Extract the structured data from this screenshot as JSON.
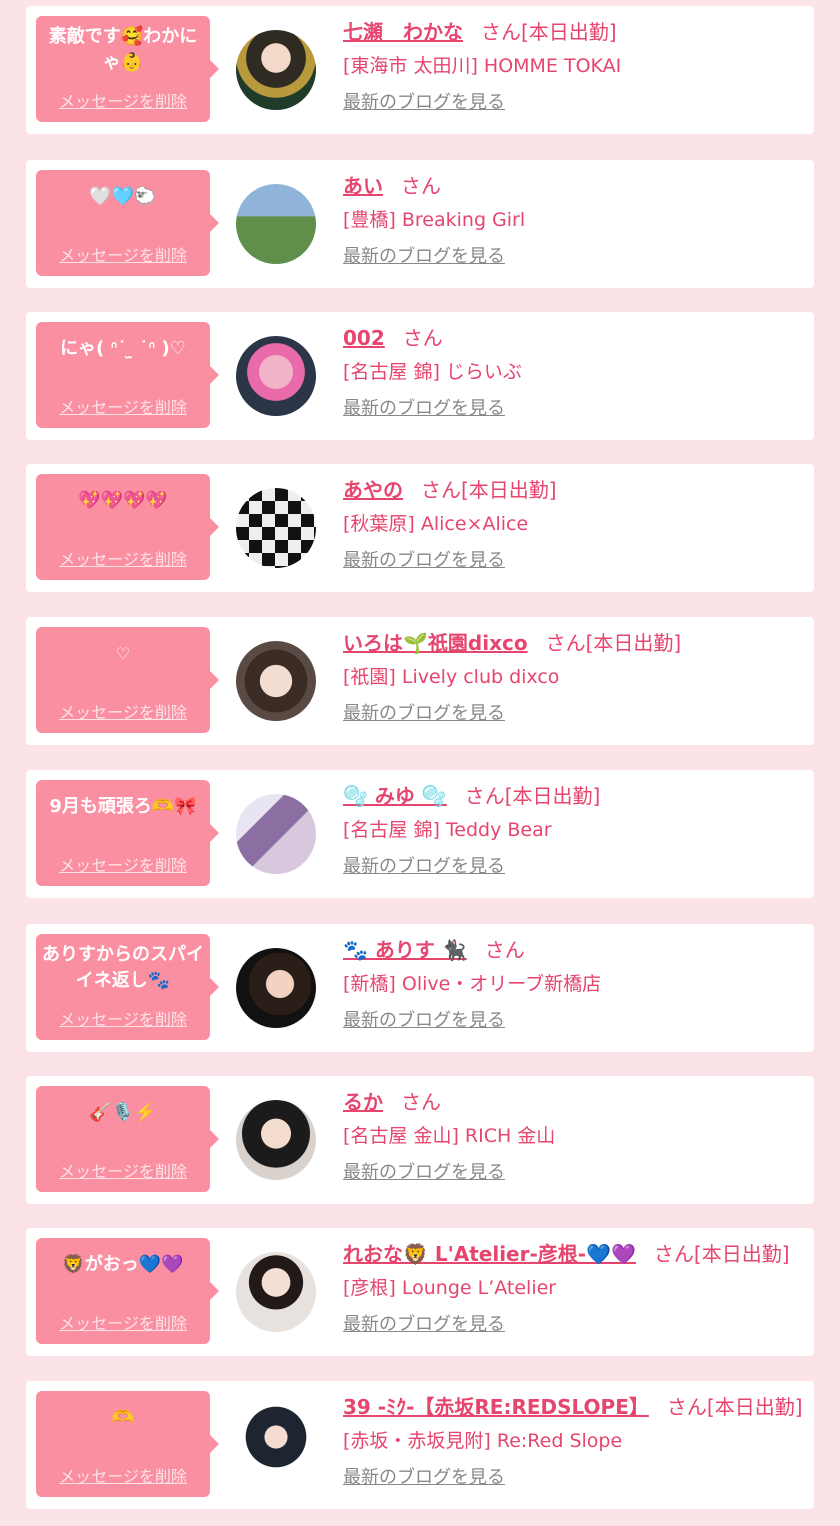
{
  "delete_label": "メッセージを削除",
  "blog_label": "最新のブログを見る",
  "san_label": "さん",
  "entries": [
    {
      "message": "素敵です🥰わかにゃ👶",
      "name": "七瀬　わかな",
      "status": "[本日出勤]",
      "shop": "[東海市 太田川] HOMME TOKAI"
    },
    {
      "message": "🤍🩵🐑",
      "name": "あい",
      "status": "",
      "shop": "[豊橋] Breaking Girl"
    },
    {
      "message": "にゃ( ᐢ˙ ̫ ˙ᐢ )♡",
      "name": "002",
      "status": "",
      "shop": "[名古屋 錦] じらいぶ"
    },
    {
      "message": "💖💖💖💖",
      "name": "あやの",
      "status": "[本日出勤]",
      "shop": "[秋葉原] Alice×Alice"
    },
    {
      "message": "♡",
      "name": "いろは🌱祇園dixco",
      "status": "[本日出勤]",
      "shop": "[祇園] Lively club dixco"
    },
    {
      "message": "9月も頑張ろ🫶🎀",
      "name": "🫧 みゆ 🫧",
      "status": "[本日出勤]",
      "shop": "[名古屋 錦] Teddy Bear"
    },
    {
      "message": "ありすからのスパイイネ返し🐾",
      "name": "🐾 ありす 🐈‍⬛",
      "status": "",
      "shop": "[新橋] Olive・オリーブ新橋店"
    },
    {
      "message": "🎸🎙️⚡️",
      "name": "るか",
      "status": "",
      "shop": "[名古屋 金山] RICH 金山"
    },
    {
      "message": "🦁がおっ💙💜",
      "name": "れおな🦁 L'Atelier-彦根-💙💜",
      "status": "[本日出勤]",
      "shop": "[彦根] Lounge L’Atelier"
    },
    {
      "message": "🫶",
      "name": "39 -ﾐｸ-【赤坂RE:REDSLOPE】",
      "status": "[本日出勤]",
      "shop": "[赤坂・赤坂見附] Re:Red Slope"
    }
  ],
  "colors": {
    "bubble": "#fb8fa2",
    "accent": "#e6456e",
    "background": "#fbe3e8",
    "link_gray": "#888888"
  }
}
